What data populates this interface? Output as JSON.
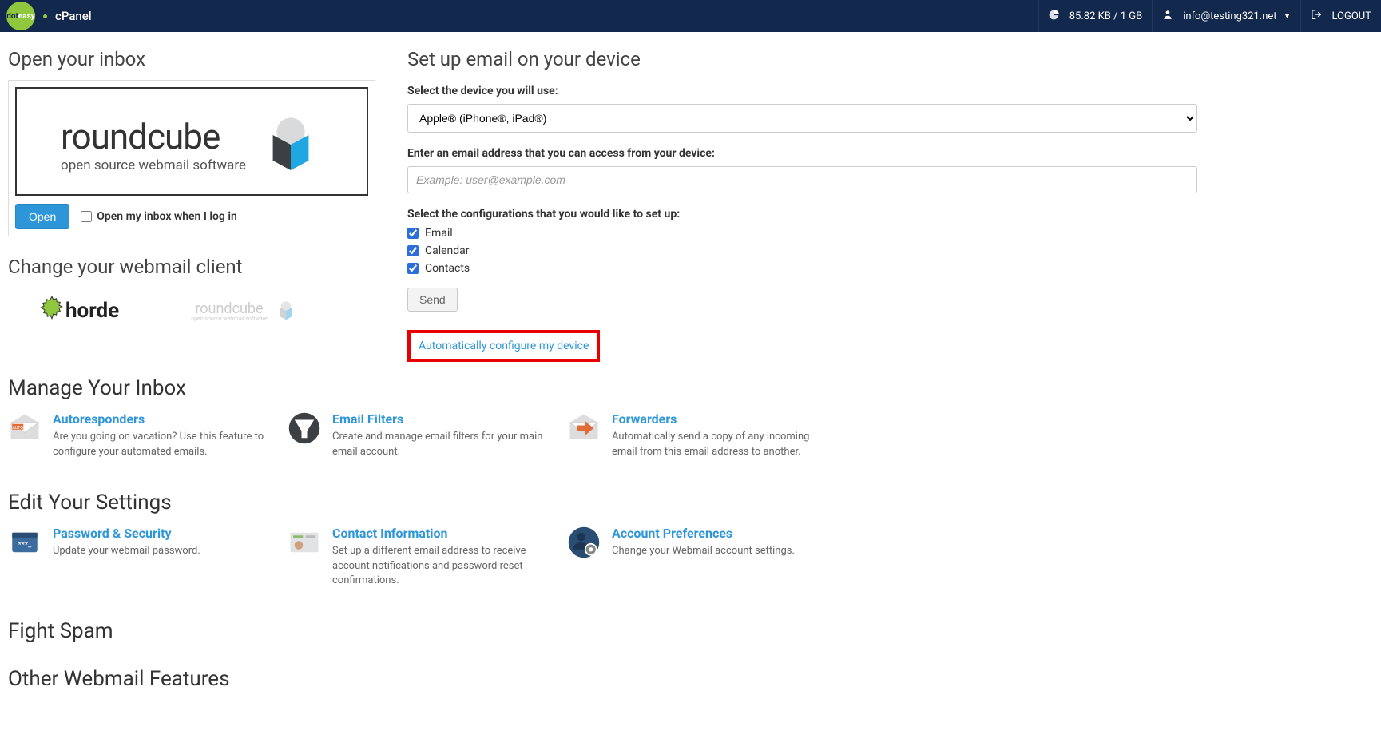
{
  "topbar": {
    "brand": "cPanel",
    "storage": "85.82 KB / 1 GB",
    "user": "info@testing321.net",
    "logout": "LOGOUT"
  },
  "inbox": {
    "heading": "Open your inbox",
    "webmail_name": "roundcube",
    "webmail_tagline": "open source webmail software",
    "open_btn": "Open",
    "open_on_login": "Open my inbox when I log in"
  },
  "change_client": {
    "heading": "Change your webmail client",
    "horde": "horde",
    "roundcube": "roundcube",
    "roundcube_sub": "open source webmail software"
  },
  "setup": {
    "heading": "Set up email on your device",
    "device_label": "Select the device you will use:",
    "device_value": "Apple® (iPhone®, iPad®)",
    "email_label": "Enter an email address that you can access from your device:",
    "email_placeholder": "Example: user@example.com",
    "config_label": "Select the configurations that you would like to set up:",
    "cfg_email": "Email",
    "cfg_calendar": "Calendar",
    "cfg_contacts": "Contacts",
    "send_btn": "Send",
    "auto_link": "Automatically configure my device"
  },
  "manage_inbox": {
    "heading": "Manage Your Inbox",
    "items": [
      {
        "title": "Autoresponders",
        "desc": "Are you going on vacation? Use this feature to configure your automated emails."
      },
      {
        "title": "Email Filters",
        "desc": "Create and manage email filters for your main email account."
      },
      {
        "title": "Forwarders",
        "desc": "Automatically send a copy of any incoming email from this email address to another."
      }
    ]
  },
  "edit_settings": {
    "heading": "Edit Your Settings",
    "items": [
      {
        "title": "Password & Security",
        "desc": "Update your webmail password."
      },
      {
        "title": "Contact Information",
        "desc": "Set up a different email address to receive account notifications and password reset confirmations."
      },
      {
        "title": "Account Preferences",
        "desc": "Change your Webmail account settings."
      }
    ]
  },
  "fight_spam": {
    "heading": "Fight Spam"
  },
  "other_features": {
    "heading": "Other Webmail Features"
  }
}
